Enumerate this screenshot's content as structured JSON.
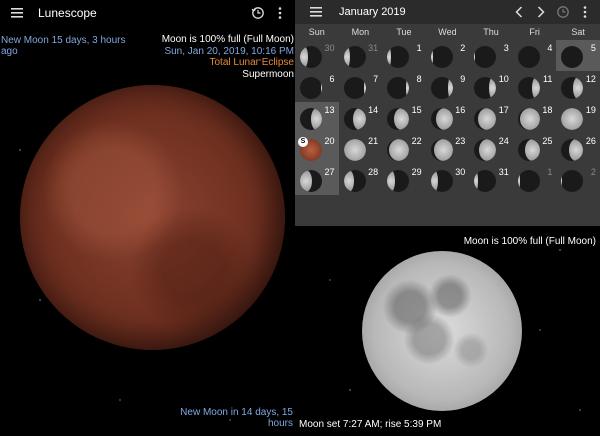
{
  "app": {
    "title": "Lunescope"
  },
  "left": {
    "last_new": "New Moon 15 days, 3 hours ago",
    "info": {
      "fullness": "Moon is 100% full (Full Moon)",
      "datetime": "Sun, Jan 20, 2019, 10:16 PM",
      "event": "Total Lunar Eclipse",
      "extra": "Supermoon"
    },
    "next_new": "New Moon in 14 days, 15 hours"
  },
  "calendar": {
    "month": "January 2019",
    "dows": [
      "Sun",
      "Mon",
      "Tue",
      "Wed",
      "Thu",
      "Fri",
      "Sat"
    ],
    "weeks": [
      [
        {
          "n": "30",
          "out": true,
          "ph": -0.35
        },
        {
          "n": "31",
          "out": true,
          "ph": -0.25
        },
        {
          "n": "1",
          "ph": -0.18
        },
        {
          "n": "2",
          "ph": -0.1
        },
        {
          "n": "3",
          "ph": -0.05
        },
        {
          "n": "4",
          "ph": 0
        },
        {
          "n": "5",
          "ph": 0,
          "sel": true
        }
      ],
      [
        {
          "n": "6",
          "ph": 0.05
        },
        {
          "n": "7",
          "ph": 0.1
        },
        {
          "n": "8",
          "ph": 0.15
        },
        {
          "n": "9",
          "ph": 0.22
        },
        {
          "n": "10",
          "ph": 0.3
        },
        {
          "n": "11",
          "ph": 0.38
        },
        {
          "n": "12",
          "ph": 0.45
        }
      ],
      [
        {
          "n": "13",
          "ph": 0.52,
          "sel": true
        },
        {
          "n": "14",
          "ph": 0.6
        },
        {
          "n": "15",
          "ph": 0.68
        },
        {
          "n": "16",
          "ph": 0.76
        },
        {
          "n": "17",
          "ph": 0.84
        },
        {
          "n": "18",
          "ph": 0.9
        },
        {
          "n": "19",
          "ph": 0.96
        }
      ],
      [
        {
          "n": "20",
          "ph": 1,
          "eclipse": true,
          "badge": "S",
          "sel": true
        },
        {
          "n": "21",
          "ph": 0.97
        },
        {
          "n": "22",
          "ph": 0.92
        },
        {
          "n": "23",
          "ph": 0.86
        },
        {
          "n": "24",
          "ph": 0.78
        },
        {
          "n": "25",
          "ph": 0.7
        },
        {
          "n": "26",
          "ph": 0.62
        }
      ],
      [
        {
          "n": "27",
          "ph": -0.55,
          "sel": true
        },
        {
          "n": "28",
          "ph": -0.47
        },
        {
          "n": "29",
          "ph": -0.38
        },
        {
          "n": "30",
          "ph": -0.3
        },
        {
          "n": "31",
          "ph": -0.2
        },
        {
          "n": "1",
          "out": true,
          "ph": -0.1
        },
        {
          "n": "2",
          "out": true,
          "ph": -0.05
        }
      ]
    ]
  },
  "right": {
    "fullness": "Moon is 100% full (Full Moon)",
    "set_rise": "Moon set 7:27 AM; rise 5:39 PM"
  }
}
